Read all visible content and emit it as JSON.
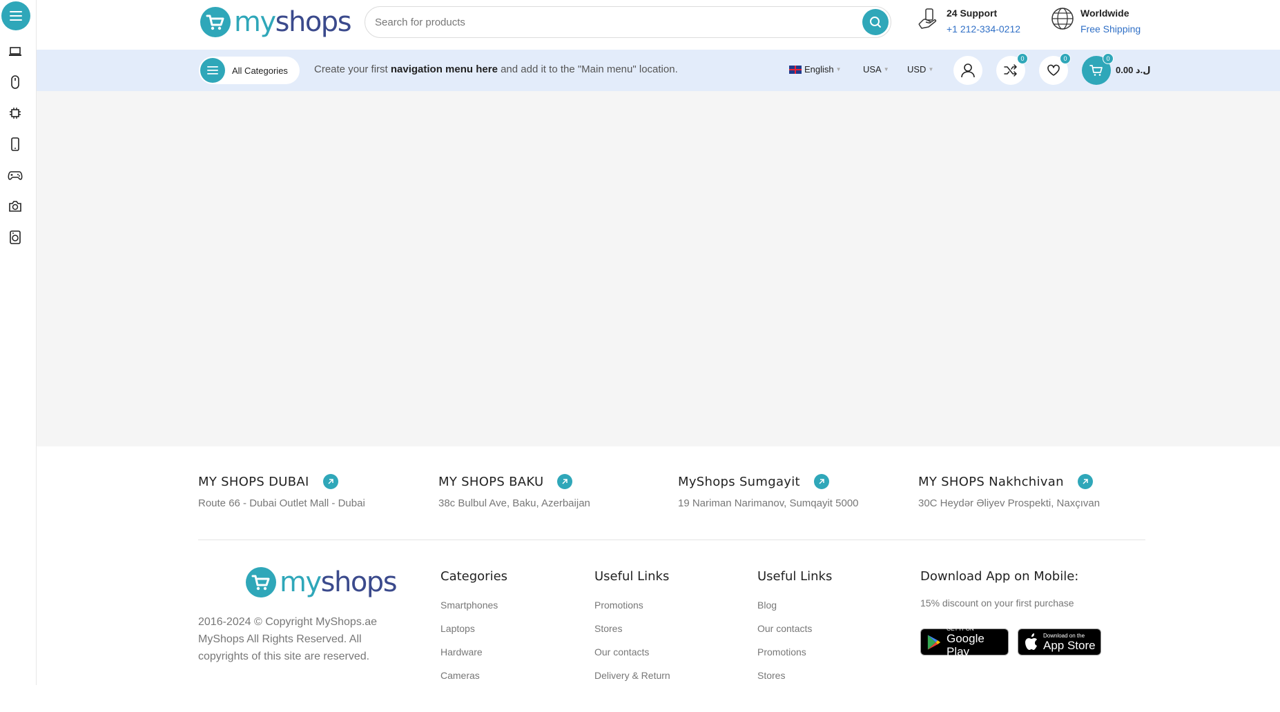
{
  "header": {
    "search_placeholder": "Search for products",
    "support_title": "24 Support",
    "support_phone": "+1 212-334-0212",
    "shipping_title": "Worldwide",
    "shipping_sub": "Free Shipping"
  },
  "logo": {
    "part1": "my",
    "part2": "shops"
  },
  "nav": {
    "all_categories": "All Categories",
    "msg_prefix": "Create your first ",
    "msg_bold": "navigation menu here",
    "msg_suffix": " and add it to the \"Main menu\" location.",
    "language": "English",
    "country": "USA",
    "currency": "USD",
    "compare_count": "0",
    "wishlist_count": "0",
    "cart_count": "0",
    "cart_total": "ل.د 0.00"
  },
  "sidebar": {
    "icons": [
      "laptop-icon",
      "mouse-icon",
      "chip-icon",
      "smartphone-icon",
      "gamepad-icon",
      "camera-icon",
      "washing-machine-icon"
    ]
  },
  "stores": [
    {
      "name": "MY SHOPS DUBAI",
      "address": "Route 66  - Dubai Outlet Mall - Dubai"
    },
    {
      "name": "MY SHOPS BAKU",
      "address": "38c Bulbul Ave, Baku, Azerbaijan"
    },
    {
      "name": "MyShops Sumgayit",
      "address": "19 Nariman Narimanov, Sumqayit 5000"
    },
    {
      "name": "MY SHOPS Nakhchivan",
      "address": "30C Heydər Əliyev Prospekti, Naxçıvan"
    }
  ],
  "footer": {
    "copyright": "2016-2024 © Copyright MyShops.ae MyShops All Rights Reserved. All copyrights of this site are reserved.",
    "categories_title": "Categories",
    "categories": [
      "Smartphones",
      "Laptops",
      "Hardware",
      "Cameras"
    ],
    "useful1_title": "Useful Links",
    "useful1": [
      "Promotions",
      "Stores",
      "Our contacts",
      "Delivery & Return"
    ],
    "useful2_title": "Useful Links",
    "useful2": [
      "Blog",
      "Our contacts",
      "Promotions",
      "Stores"
    ],
    "app_title": "Download App on Mobile:",
    "app_sub": "15% discount on your first purchase",
    "google_small": "GET IT ON",
    "google_big": "Google Play",
    "apple_small": "Download on the",
    "apple_big": "App Store"
  },
  "colors": {
    "accent": "#2fa7b9",
    "brand_dark": "#3b4a8c",
    "nav_bg": "#e3ecfa",
    "link_blue": "#2f6fc6"
  }
}
